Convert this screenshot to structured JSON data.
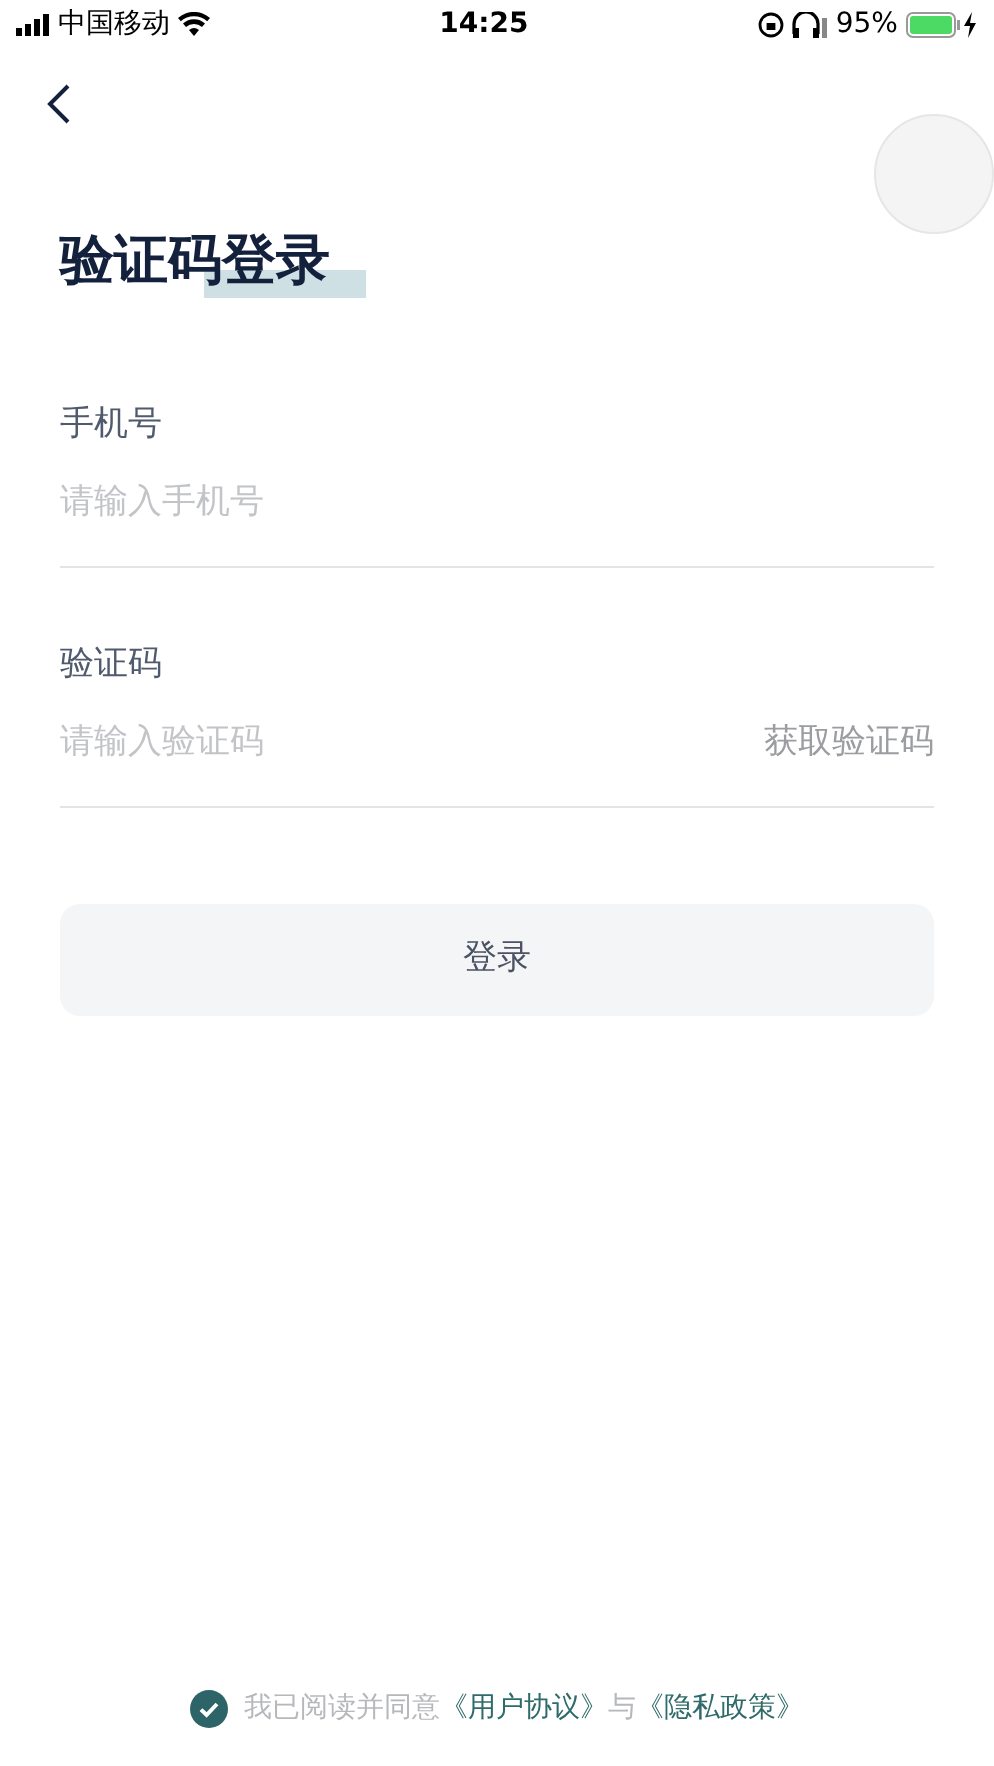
{
  "status_bar": {
    "carrier": "中国移动",
    "time": "14:25",
    "battery": "95%"
  },
  "title": "验证码登录",
  "fields": [
    {
      "label": "手机号",
      "placeholder": "请输入手机号"
    },
    {
      "label": "验证码",
      "placeholder": "请输入验证码",
      "action": "获取验证码"
    }
  ],
  "login_button": "登录",
  "agreement": {
    "checked": true,
    "text": "我已阅读并同意",
    "links": [
      "《用户协议》",
      "《隐私政策》"
    ],
    "joiner": "与"
  }
}
